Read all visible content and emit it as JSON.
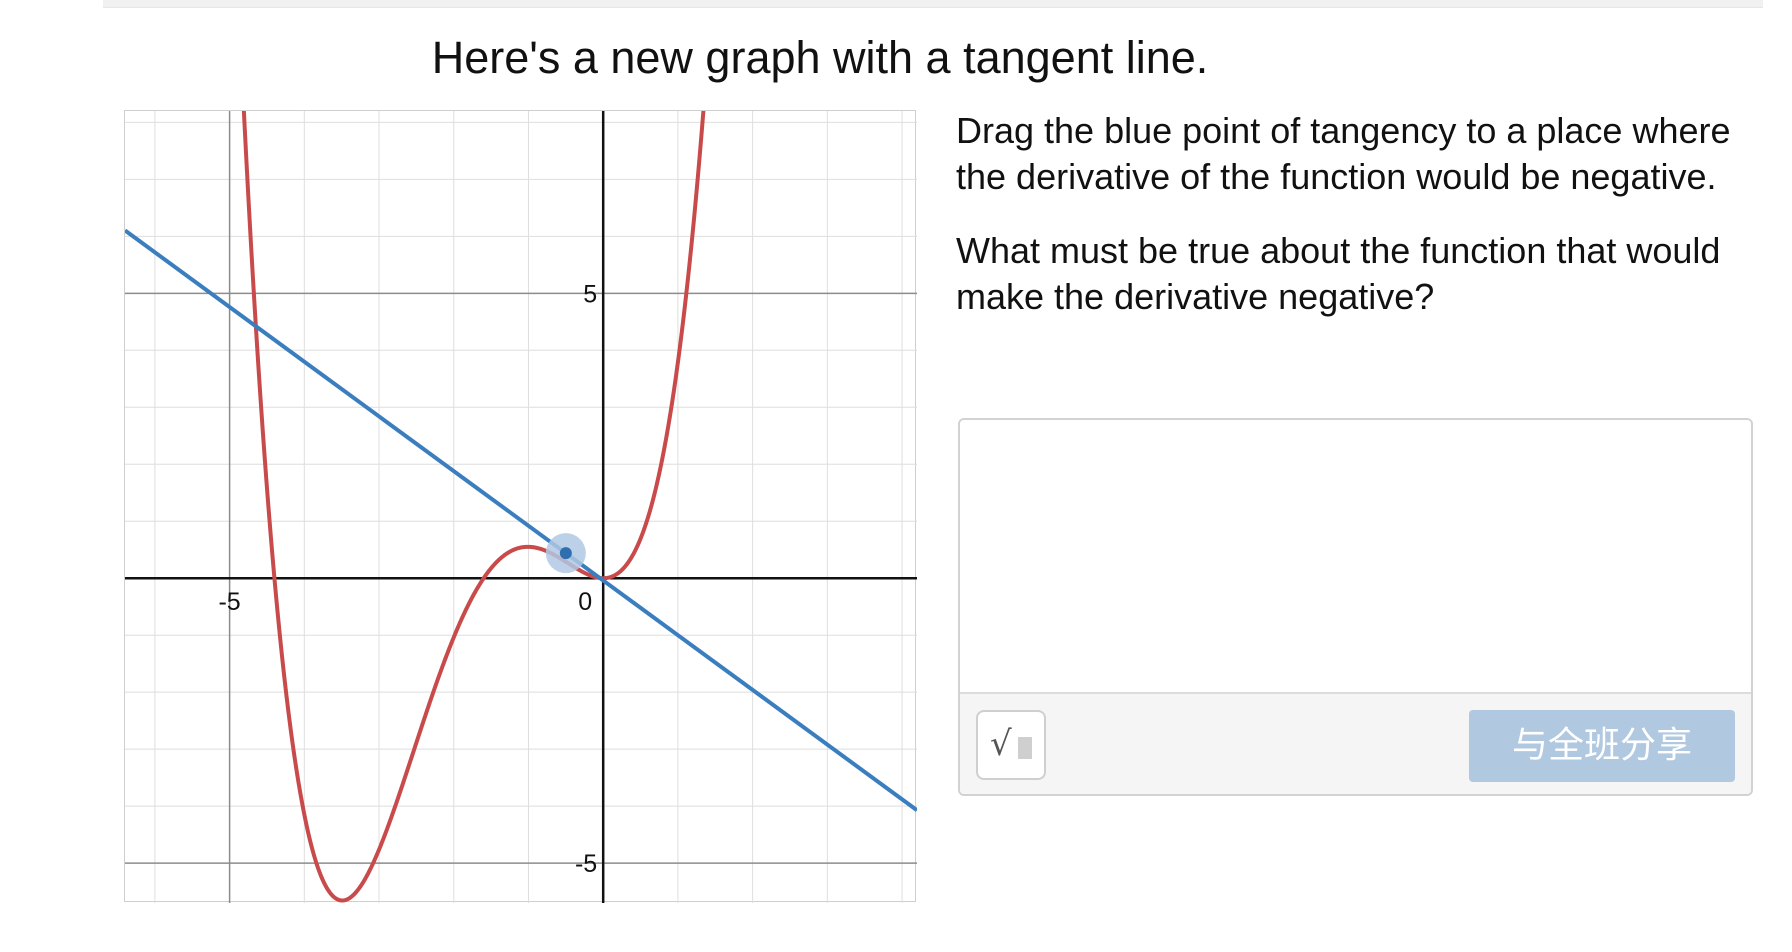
{
  "title": "Here's a new graph with a tangent line.",
  "prompt": {
    "instruction": "Drag the blue point of tangency to a place where the derivative of the function would be negative.",
    "question": "What must be true about the function that would make the derivative negative?"
  },
  "response": {
    "value": "",
    "placeholder": "",
    "math_button_icon": "sqrt-icon",
    "share_label": "与全班分享"
  },
  "graph": {
    "x_range": [
      -6.4,
      4.2
    ],
    "y_range": [
      -5.7,
      8.2
    ],
    "x_ticks": [
      "-5",
      "0"
    ],
    "y_ticks": [
      "5",
      "-5"
    ],
    "function_color": "#c94a4a",
    "tangent_color": "#3a7ebf",
    "point_color": "#2f6fb0",
    "point_halo_color": "#b0c8e3",
    "tangent_point": {
      "x": -0.5,
      "y": 0.44
    },
    "tangent_slope": -0.96
  }
}
